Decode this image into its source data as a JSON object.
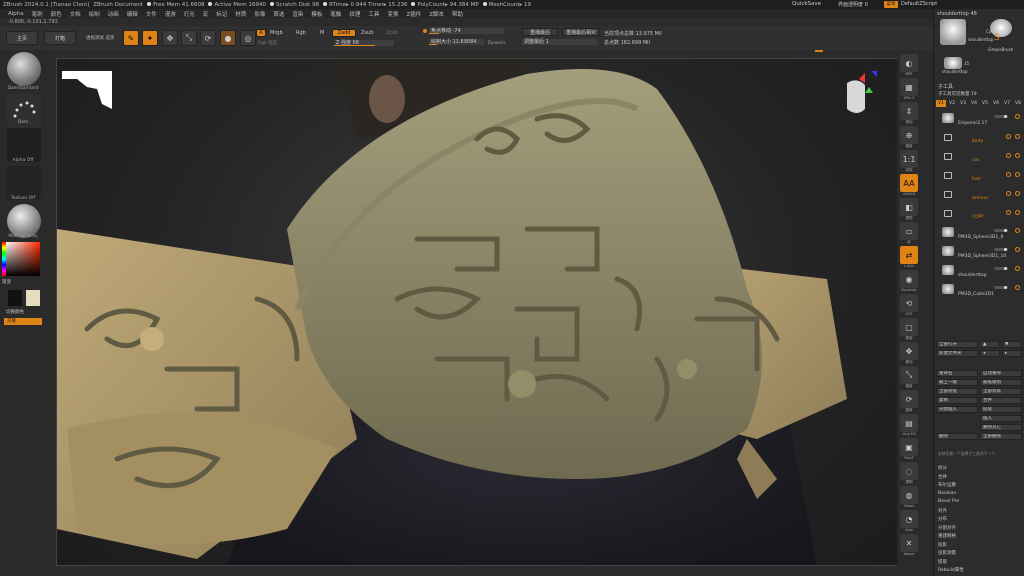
{
  "titlebar": {
    "app": "ZBrush 2024.0.1 [Tianao Chen]",
    "doc": "ZBrush Document",
    "free_mem": "Free Mem 41.6608",
    "active_mem": "Active Mem 16940",
    "scratch": "Scratch Disk 98",
    "rtime": "RTime▸ 0.944 Timer▸ 15.236",
    "polycount": "PolyCount▸ 94.384 MP",
    "meshcount": "MeshCount▸ 19",
    "quicksave": "QuickSave",
    "transparency": "界面透明度 0",
    "menus_btn": "菜单",
    "script": "DefaultZScript"
  },
  "menubar": [
    "Alpha",
    "笔刷",
    "颜色",
    "文档",
    "绘制",
    "动画",
    "编辑",
    "文件",
    "漫游",
    "灯光",
    "宏",
    "标记",
    "材质",
    "影像",
    "首选",
    "渲染",
    "模板",
    "笔触",
    "纹理",
    "工具",
    "变换",
    "Z插件",
    "Z脚本",
    "帮助"
  ],
  "coords": "-0.806,-0.191,1.793",
  "shelf": {
    "home": "主页",
    "lightbox": "灯箱",
    "zproject": "透视测试 选项",
    "edit": "Edit",
    "draw": "Draw",
    "move": "Move",
    "scale": "Scale",
    "rotate": "Rotate",
    "a": "A",
    "mrgb": "Mrgb",
    "rgb": "Rgb",
    "m": "M",
    "zadd": "Zadd",
    "zsub": "Zsub",
    "zcut": "Zcut",
    "rgb_intensity": "Rgb 强度",
    "z_intensity": "Z 强度 68",
    "focal_shift": "焦点移动 -74",
    "draw_size": "绘制大小 11.69084",
    "dynamic": "Dynamic",
    "replay_last": "重播最后",
    "replay_last_rel": "重播最后相对",
    "adjust_last": "调整最后 1",
    "active_points": "当前顶点总数 13.975 Mil",
    "total_points": "总点数 182.699 Mil"
  },
  "left": {
    "brush": "DamStandard",
    "stroke": "Dots",
    "alpha": "Alpha Off",
    "texture": "Texture Off",
    "material": "MatCap Gray",
    "gradient": "渐变",
    "switch_color": "切换颜色",
    "alternate": "交替"
  },
  "rtool": [
    "BPR",
    "SPix 3",
    "滚动",
    "缩放",
    "实际",
    "AAHalf",
    "透视",
    "床",
    "L.Sym",
    "Dynamic",
    "XYZ",
    "框架",
    "移动",
    "缩放",
    "旋转",
    "Line Fill",
    "PolyF",
    "透明",
    "Ghost",
    "Solo",
    "Xpose"
  ],
  "rpanel": {
    "current_tool": "shoulderttop",
    "count": "48",
    "thumbs": [
      "shoulderttop",
      "Cylinder3D",
      "SimpleBrush",
      "shoulderttop"
    ],
    "thumb_count": "35",
    "section": "子工具",
    "visible_count": "子工具可见数量 19",
    "tabs": [
      "V1",
      "V2",
      "V3",
      "V4",
      "V5",
      "V6",
      "V7",
      "V8"
    ],
    "subtools": [
      {
        "name": "Emperor2.17",
        "type": "mesh"
      },
      {
        "name": "body",
        "type": "folder"
      },
      {
        "name": "cos",
        "type": "folder"
      },
      {
        "name": "hair",
        "type": "folder"
      },
      {
        "name": "armour",
        "type": "folder"
      },
      {
        "name": "COPY",
        "type": "folder"
      },
      {
        "name": "PM3D_Sphere3D1_9",
        "type": "mesh"
      },
      {
        "name": "PM3D_Sphere3D1_10",
        "type": "mesh"
      },
      {
        "name": "shoulderttop",
        "type": "mesh"
      },
      {
        "name": "PM3D_Cube3D1",
        "type": "mesh"
      }
    ],
    "buttons": {
      "all_open": "全部打开",
      "new_folder": "新建文件夹",
      "rename": "重命名",
      "auto_rename": "自动重命",
      "top": "最上一级",
      "all_low": "最低级别",
      "all_to_low": "全部到低",
      "all_to_high": "全部到高",
      "copy": "复制",
      "merge": "合并",
      "append": "分配插入",
      "extract": "提取",
      "insert": "插入",
      "del_hidden": "删除其它",
      "delete": "删除",
      "del_all": "全部删除"
    },
    "group_hint": "安装切换一个选择子工具到下一个",
    "bottom_list": [
      "拆分",
      "合并",
      "布尔运算",
      "Boolean",
      "Bevel Pro",
      "对齐",
      "分布",
      "分割对齐",
      "重建网格",
      "投影",
      "投影测量",
      "提取",
      "Rebuild属性"
    ]
  },
  "colors": {
    "accent": "#e08418",
    "panel": "#2c2c2c",
    "armor": "#9c9470"
  }
}
